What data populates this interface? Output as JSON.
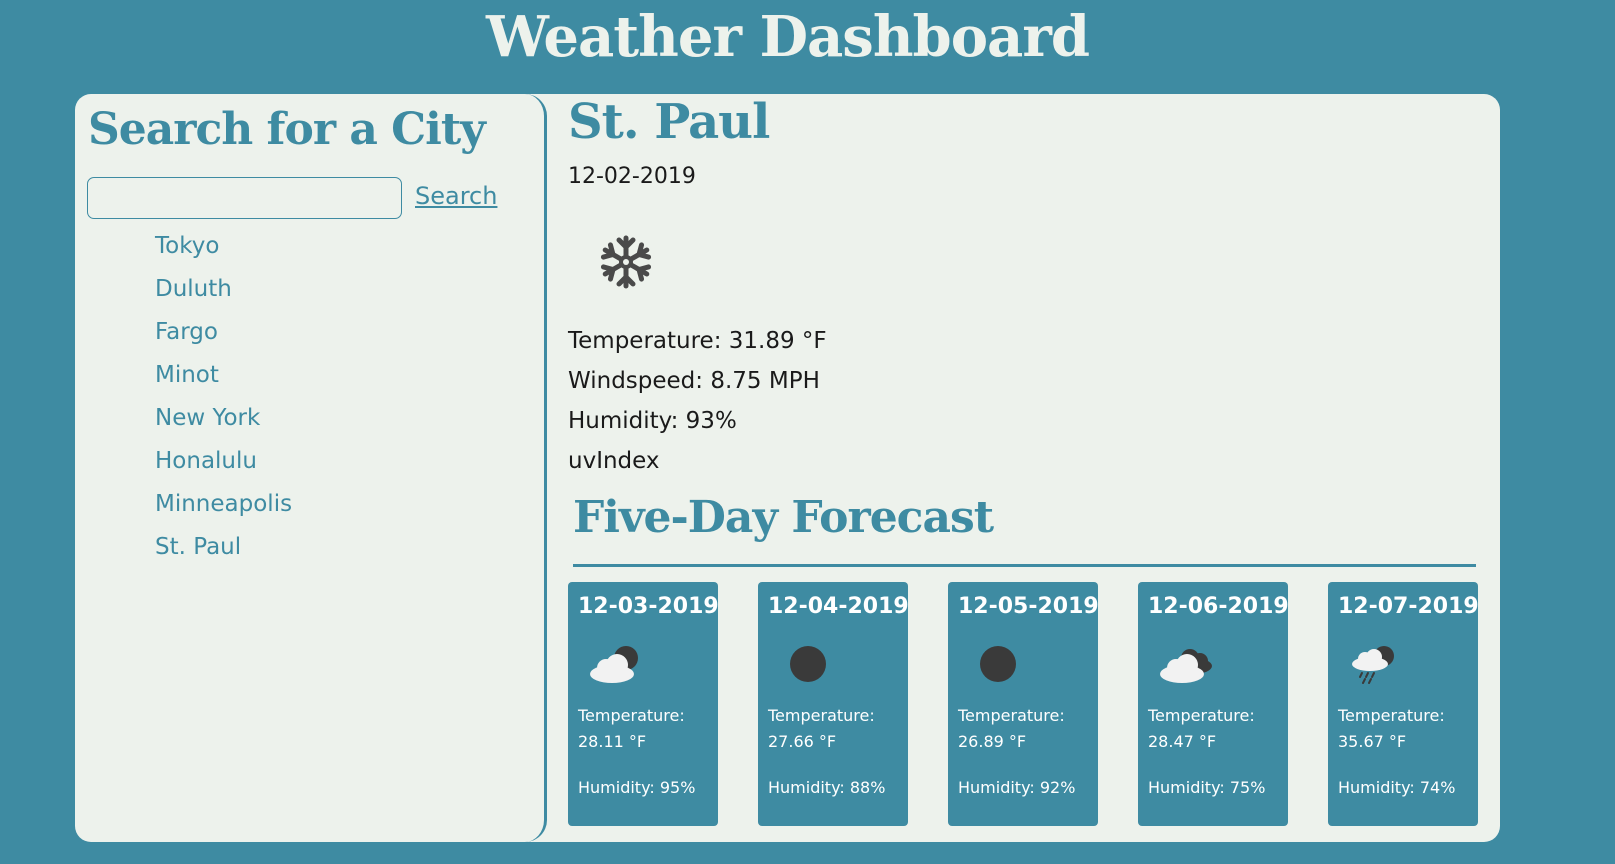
{
  "header": {
    "title": "Weather Dashboard"
  },
  "sidebar": {
    "title": "Search for a City",
    "search_placeholder": "",
    "search_value": "",
    "search_label": "Search",
    "cities": [
      "Tokyo",
      "Duluth",
      "Fargo",
      "Minot",
      "New York",
      "Honalulu",
      "Minneapolis",
      "St. Paul"
    ]
  },
  "current": {
    "city": "St. Paul",
    "date": "12-02-2019",
    "icon": "snowflake-icon",
    "temperature": "Temperature: 31.89 °F",
    "windspeed": "Windspeed: 8.75 MPH",
    "humidity": "Humidity: 93%",
    "uv_label": "uvIndex"
  },
  "forecast": {
    "title": "Five-Day Forecast",
    "temp_label": "Temperature:",
    "days": [
      {
        "date": "12-03-2019",
        "icon": "partly-cloudy-night-icon",
        "temp": "28.11 °F",
        "humidity": "Humidity: 95%"
      },
      {
        "date": "12-04-2019",
        "icon": "clear-night-icon",
        "temp": "27.66 °F",
        "humidity": "Humidity: 88%"
      },
      {
        "date": "12-05-2019",
        "icon": "clear-night-icon",
        "temp": "26.89 °F",
        "humidity": "Humidity: 92%"
      },
      {
        "date": "12-06-2019",
        "icon": "broken-clouds-icon",
        "temp": "28.47 °F",
        "humidity": "Humidity: 75%"
      },
      {
        "date": "12-07-2019",
        "icon": "rain-night-icon",
        "temp": "35.67 °F",
        "humidity": "Humidity: 74%"
      }
    ]
  },
  "colors": {
    "background": "#3e8ba2",
    "panel": "#edf2ec",
    "accent": "#3e8ba2",
    "text": "#1a1a1a"
  }
}
